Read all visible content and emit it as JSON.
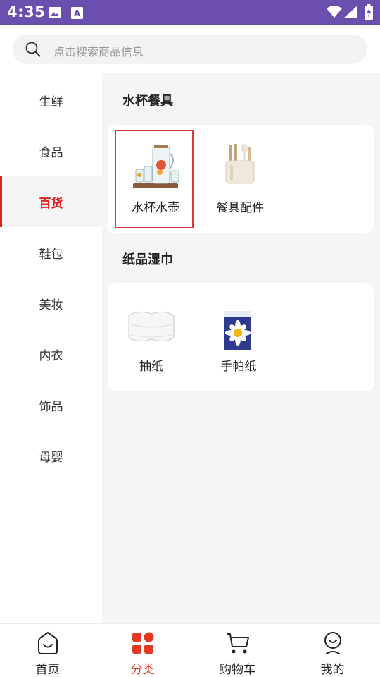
{
  "status_bar": {
    "time": "4:35"
  },
  "search": {
    "placeholder": "点击搜索商品信息"
  },
  "sidebar": {
    "items": [
      {
        "label": "生鲜"
      },
      {
        "label": "食品"
      },
      {
        "label": "百货"
      },
      {
        "label": "鞋包"
      },
      {
        "label": "美妆"
      },
      {
        "label": "内衣"
      },
      {
        "label": "饰品"
      },
      {
        "label": "母婴"
      }
    ],
    "active_label": "百货"
  },
  "sections": [
    {
      "title": "水杯餐具",
      "items": [
        {
          "label": "水杯水壶",
          "icon": "water-pitcher-set-image",
          "selected": true
        },
        {
          "label": "餐具配件",
          "icon": "utensil-holder-image"
        }
      ]
    },
    {
      "title": "纸品湿巾",
      "items": [
        {
          "label": "抽纸",
          "icon": "tissue-pack-image"
        },
        {
          "label": "手帕纸",
          "icon": "handkerchief-paper-image"
        }
      ]
    }
  ],
  "tabbar": {
    "items": [
      {
        "label": "首页",
        "icon": "home-icon"
      },
      {
        "label": "分类",
        "icon": "category-icon"
      },
      {
        "label": "购物车",
        "icon": "cart-icon"
      },
      {
        "label": "我的",
        "icon": "profile-icon"
      }
    ],
    "active_label": "分类"
  },
  "colors": {
    "status_bar": "#6a4fae",
    "accent": "#d8261c",
    "tab_active": "#e23a22",
    "content_bg": "#f5f5f5"
  }
}
